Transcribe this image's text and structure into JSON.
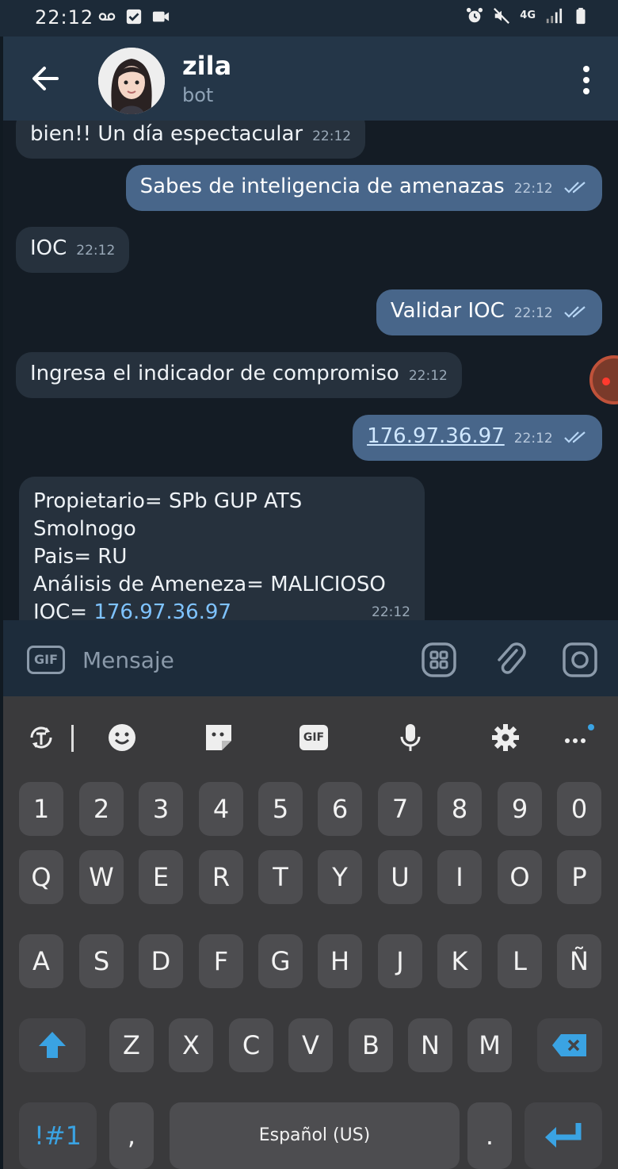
{
  "status_bar": {
    "time": "22:12",
    "network": "4G"
  },
  "header": {
    "name": "zila",
    "subtitle": "bot"
  },
  "messages": [
    {
      "dir": "in",
      "text": "bien!! Un día espectacular",
      "time": "22:12"
    },
    {
      "dir": "out",
      "text": "Sabes de inteligencia de amenazas",
      "time": "22:12"
    },
    {
      "dir": "in",
      "text": "IOC",
      "time": "22:12"
    },
    {
      "dir": "out",
      "text": "Validar IOC",
      "time": "22:12"
    },
    {
      "dir": "in",
      "text": "Ingresa el indicador de compromiso",
      "time": "22:12"
    },
    {
      "dir": "out",
      "link": "176.97.36.97",
      "time": "22:12"
    },
    {
      "dir": "in",
      "lines": [
        "Propietario= SPb GUP ATS Smolnogo",
        "Pais= RU",
        "Análisis de Ameneza= MALICIOSO"
      ],
      "ioc_label": "IOC= ",
      "ioc_link": "176.97.36.97",
      "time": "22:12"
    }
  ],
  "input": {
    "gif_label": "GIF",
    "placeholder": "Mensaje"
  },
  "keyboard": {
    "toolbar": {
      "gif_label": "GIF"
    },
    "rows": [
      [
        "1",
        "2",
        "3",
        "4",
        "5",
        "6",
        "7",
        "8",
        "9",
        "0"
      ],
      [
        "Q",
        "W",
        "E",
        "R",
        "T",
        "Y",
        "U",
        "I",
        "O",
        "P"
      ],
      [
        "A",
        "S",
        "D",
        "F",
        "G",
        "H",
        "J",
        "K",
        "L",
        "Ñ"
      ],
      [
        "Z",
        "X",
        "C",
        "V",
        "B",
        "N",
        "M"
      ]
    ],
    "symbols_label": "!#1",
    "comma_label": ",",
    "space_label": "Español (US)",
    "period_label": "."
  },
  "colors": {
    "outgoing_bubble": "#48668a",
    "incoming_bubble": "#26313d",
    "link": "#7fc3ff",
    "accent": "#3aa3e3"
  }
}
